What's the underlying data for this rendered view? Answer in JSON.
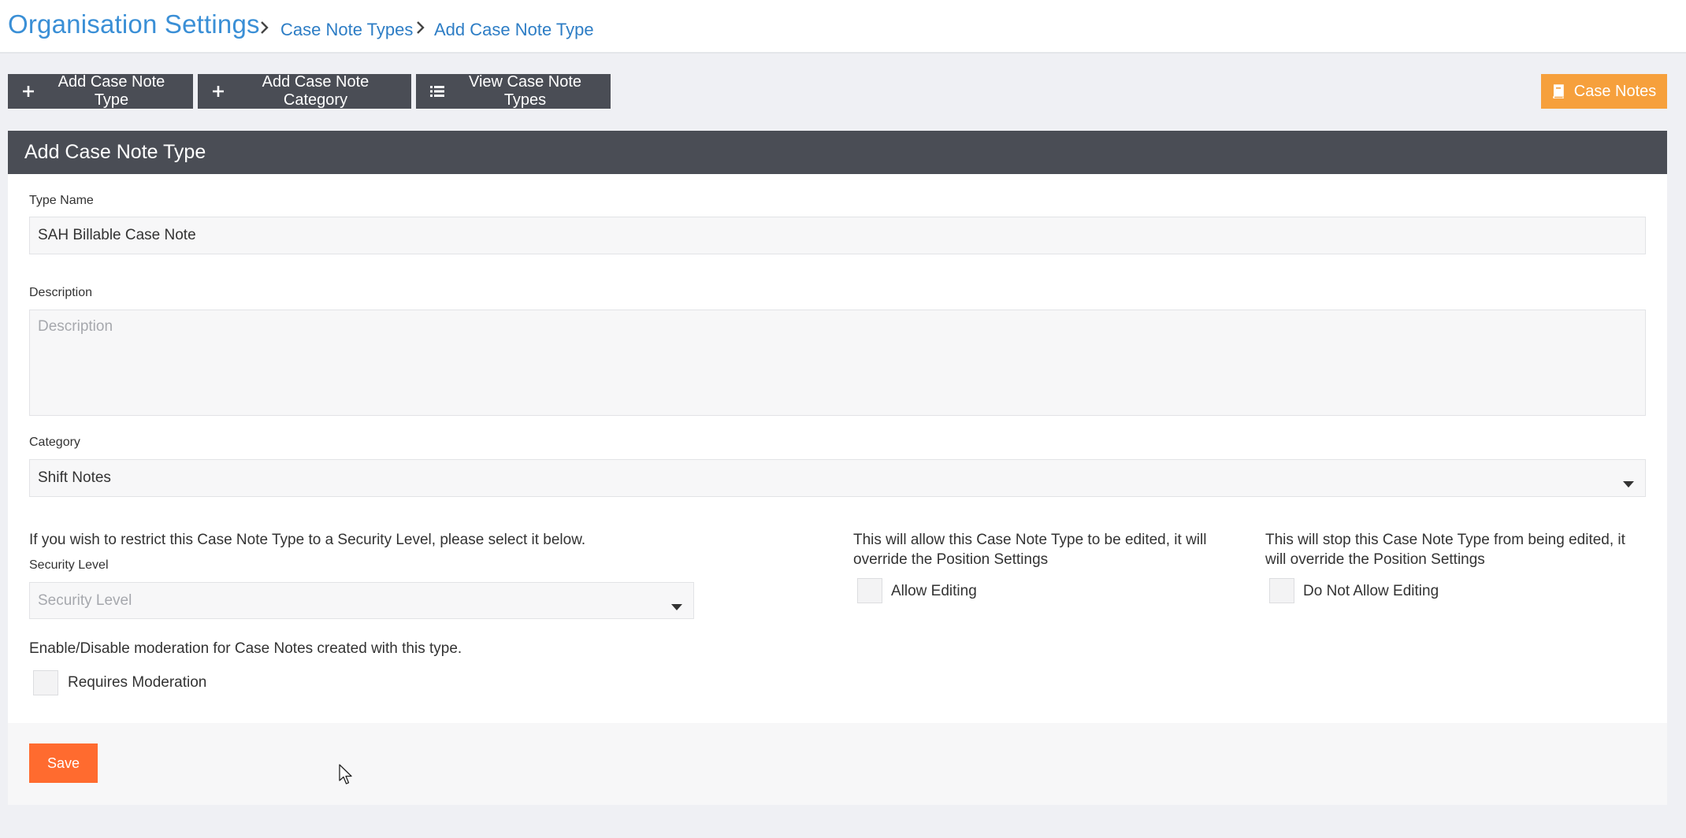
{
  "breadcrumb": {
    "title": "Organisation Settings",
    "items": [
      "Case Note Types",
      "Add Case Note Type"
    ]
  },
  "toolbar": {
    "add_type_label": "Add Case Note Type",
    "add_category_label": "Add Case Note Category",
    "view_types_label": "View Case Note Types",
    "case_notes_label": "Case Notes",
    "icons": [
      "plus-icon",
      "plus-icon",
      "list-icon",
      "book-icon"
    ]
  },
  "panel": {
    "title": "Add Case Note Type"
  },
  "form": {
    "type_name": {
      "label": "Type Name",
      "value": "SAH Billable Case Note"
    },
    "description": {
      "label": "Description",
      "placeholder": "Description"
    },
    "category": {
      "label": "Category",
      "value": "Shift Notes"
    },
    "security": {
      "intro": "If you wish to restrict this Case Note Type to a Security Level, please select it below.",
      "label": "Security Level",
      "placeholder": "Security Level"
    },
    "allow_editing": {
      "intro": "This will allow this Case Note Type to be edited, it will override the Position Settings",
      "label": "Allow Editing",
      "checked": false
    },
    "do_not_allow_editing": {
      "intro": "This will stop this Case Note Type from being edited, it will override the Position Settings",
      "label": "Do Not Allow Editing",
      "checked": false
    },
    "moderation": {
      "intro": "Enable/Disable moderation for Case Notes created with this type.",
      "label": "Requires Moderation",
      "checked": false
    }
  },
  "footer": {
    "save_label": "Save"
  },
  "colors": {
    "link": "#2d7dc5",
    "dark_button": "#4a4d55",
    "orange_button": "#f6a03c",
    "save_button": "#ff6b2f"
  }
}
